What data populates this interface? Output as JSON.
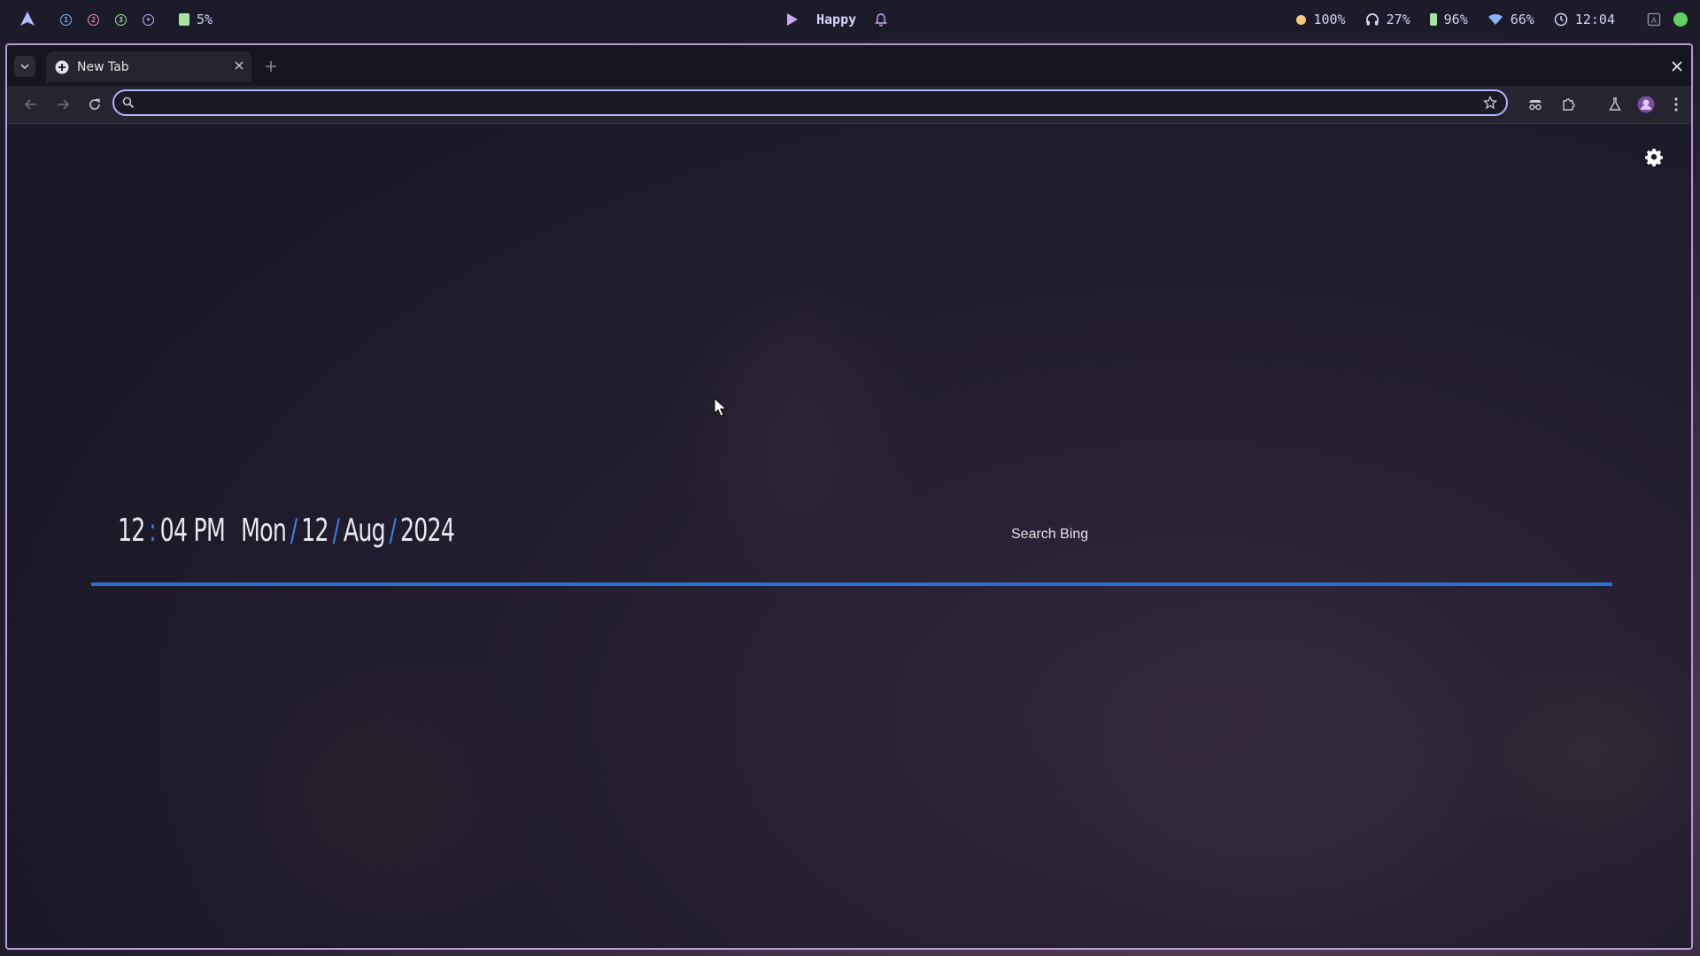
{
  "topbar": {
    "launcher_icon": "arch-logo-icon",
    "workspaces": [
      {
        "label": "1",
        "color": "#89b4fa"
      },
      {
        "label": "2",
        "color": "#f38ba8"
      },
      {
        "label": "3",
        "color": "#a6e3a1"
      },
      {
        "label": "•",
        "color": "#cba6f7"
      }
    ],
    "cpu_percent": "5%",
    "media_title": "Happy",
    "brightness": "100%",
    "headphone_volume": "27%",
    "battery": "96%",
    "wifi": "66%",
    "time": "12:04"
  },
  "browser": {
    "tab_title": "New Tab",
    "url_value": "",
    "colors": {
      "accent": "#2b6fd6",
      "border": "#b79ad0"
    }
  },
  "newtab": {
    "clock": {
      "hour": "12",
      "colon": ":",
      "minute": "04",
      "ampm": "PM",
      "weekday": "Mon",
      "slash": "/",
      "day": "12",
      "month": "Aug",
      "year": "2024"
    },
    "search_label": "Search Bing"
  }
}
